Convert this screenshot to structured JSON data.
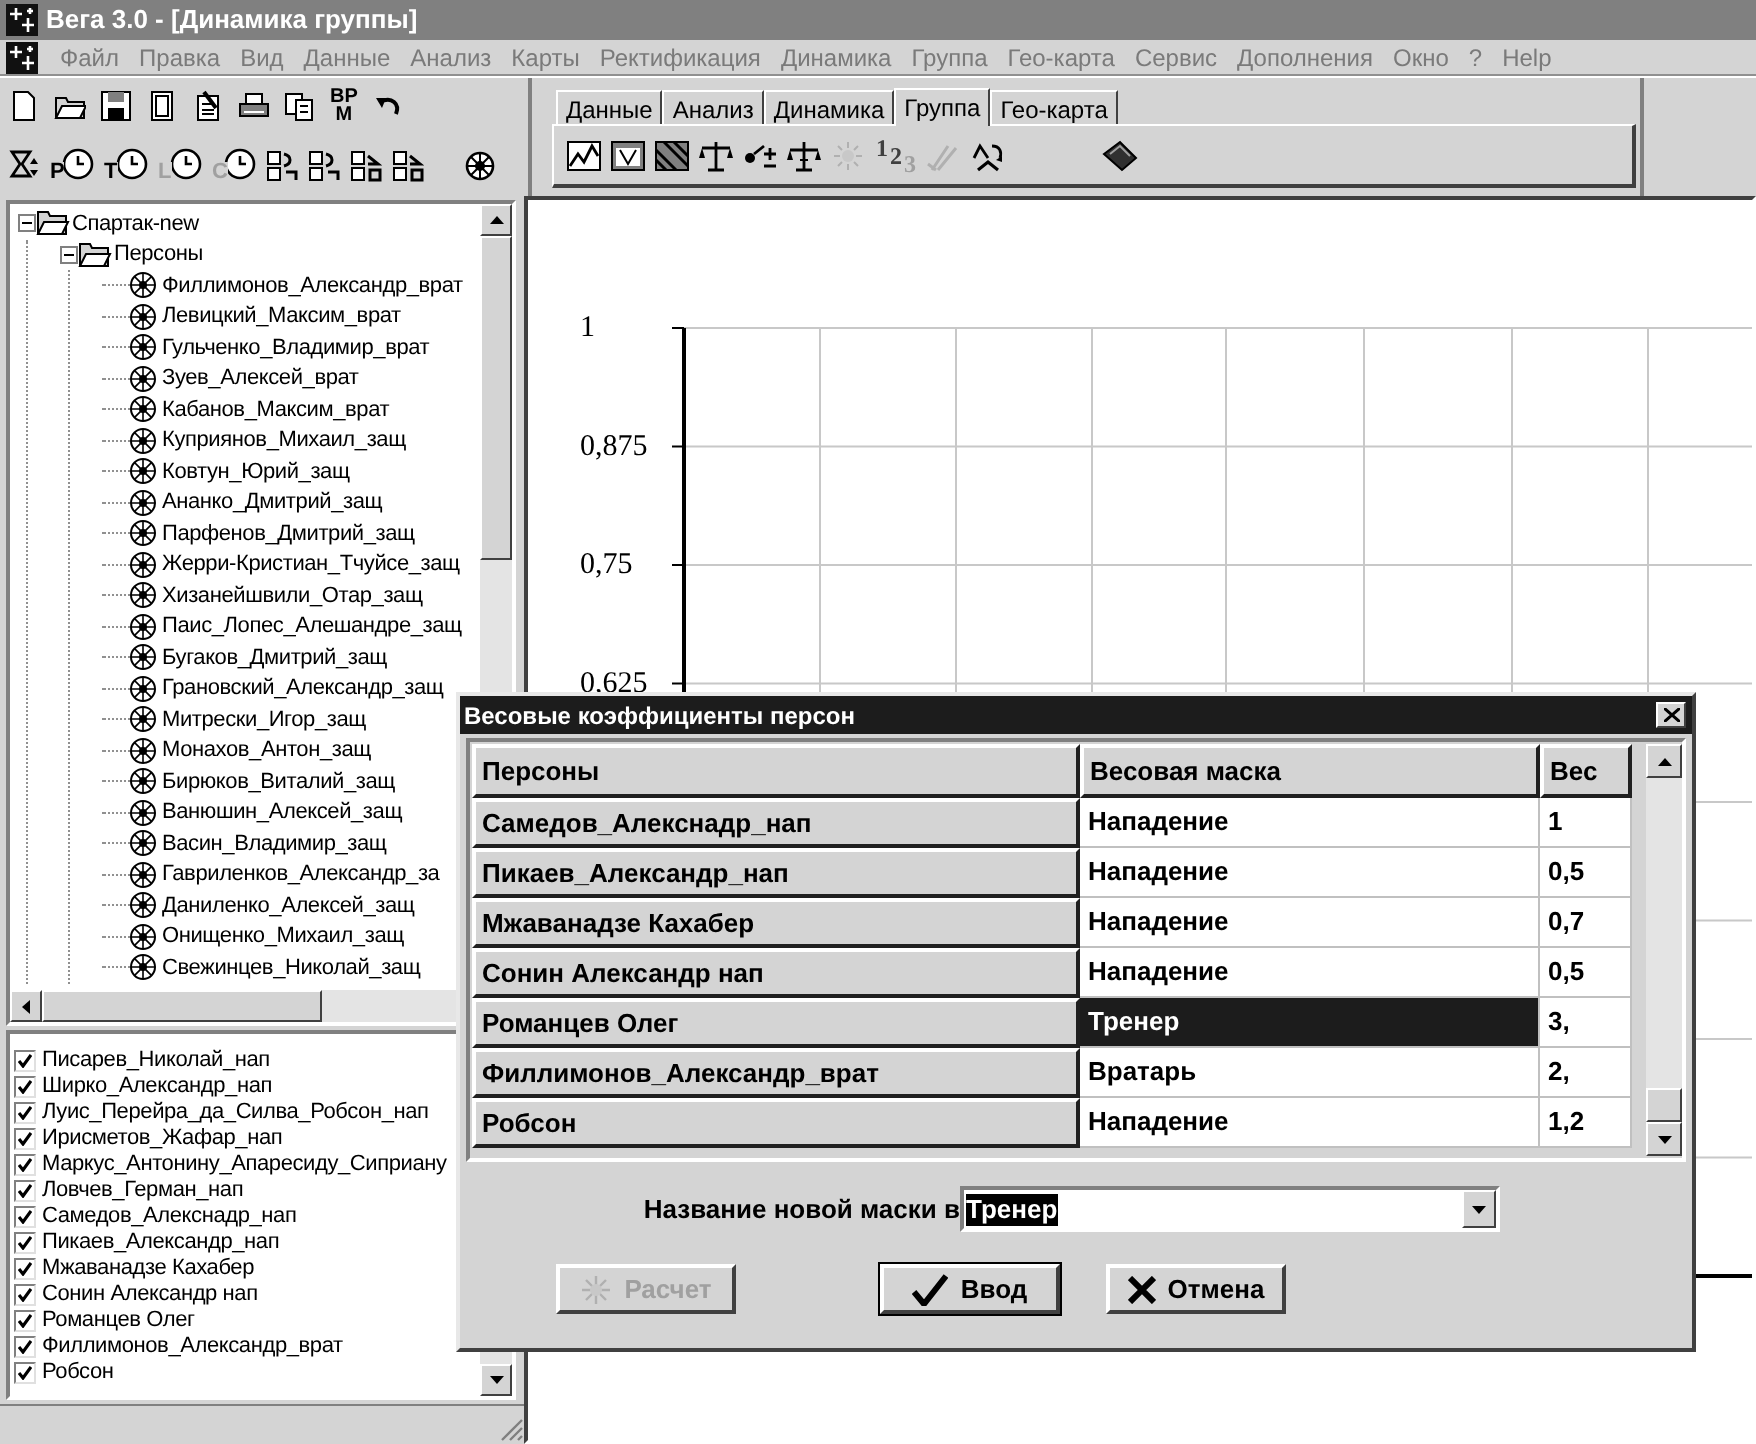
{
  "window": {
    "title": "Вега 3.0 - [Динамика группы]"
  },
  "menu": [
    "Файл",
    "Правка",
    "Вид",
    "Данные",
    "Анализ",
    "Карты",
    "Ректификация",
    "Динамика",
    "Группа",
    "Гео-карта",
    "Сервис",
    "Дополнения",
    "Окно",
    "?",
    "Help"
  ],
  "toolbar": {
    "report_label": [
      "BP",
      "M"
    ],
    "clock_letters": [
      "P",
      "T",
      "L",
      "C"
    ]
  },
  "tabs": [
    {
      "label": "Данные",
      "selected": false
    },
    {
      "label": "Анализ",
      "selected": false
    },
    {
      "label": "Динамика",
      "selected": false
    },
    {
      "label": "Группа",
      "selected": true
    },
    {
      "label": "Гео-карта",
      "selected": false
    }
  ],
  "tab_toolbar": {
    "numbering_label": [
      "1",
      "2",
      "3"
    ]
  },
  "tree": [
    {
      "label": "Спартак-new",
      "expanded": true,
      "children": [
        {
          "label": "Персоны",
          "expanded": true,
          "children": [
            {
              "label": "Филлимонов_Александр_врат"
            },
            {
              "label": "Левицкий_Максим_врат"
            },
            {
              "label": "Гульченко_Владимир_врат"
            },
            {
              "label": "Зуев_Алексей_врат"
            },
            {
              "label": "Кабанов_Максим_врат"
            },
            {
              "label": "Куприянов_Михаил_защ"
            },
            {
              "label": "Ковтун_Юрий_защ"
            },
            {
              "label": "Ананко_Дмитрий_защ"
            },
            {
              "label": "Парфенов_Дмитрий_защ"
            },
            {
              "label": "Жерри-Кристиан_Тчуйсе_защ"
            },
            {
              "label": "Хизанейшвили_Отар_защ"
            },
            {
              "label": "Паис_Лопес_Алешандре_защ"
            },
            {
              "label": "Бугаков_Дмитрий_защ"
            },
            {
              "label": "Грановский_Александр_защ"
            },
            {
              "label": "Митрески_Игор_защ"
            },
            {
              "label": "Монахов_Антон_защ"
            },
            {
              "label": "Бирюков_Виталий_защ"
            },
            {
              "label": "Ванюшин_Алексей_защ"
            },
            {
              "label": "Васин_Владимир_защ"
            },
            {
              "label": "Гавриленков_Александр_за"
            },
            {
              "label": "Даниленко_Алексей_защ"
            },
            {
              "label": "Онищенко_Михаил_защ"
            },
            {
              "label": "Свежинцев_Николай_защ"
            }
          ]
        }
      ]
    }
  ],
  "checklist": [
    {
      "label": "Писарев_Николай_нап",
      "checked": true
    },
    {
      "label": "Ширко_Александр_нап",
      "checked": true
    },
    {
      "label": "Луис_Перейра_да_Силва_Робсон_нап",
      "checked": true
    },
    {
      "label": "Ирисметов_Жафар_нап",
      "checked": true
    },
    {
      "label": "Маркус_Антонину_Апаресиду_Сиприану",
      "checked": true
    },
    {
      "label": "Ловчев_Герман_нап",
      "checked": true
    },
    {
      "label": "Самедов_Алекснадр_нап",
      "checked": true
    },
    {
      "label": "Пикаев_Александр_нап",
      "checked": true
    },
    {
      "label": "Мжаванадзе Кахабер",
      "checked": true
    },
    {
      "label": "Сонин Александр нап",
      "checked": true
    },
    {
      "label": "Романцев Олег",
      "checked": true
    },
    {
      "label": "Филлимонов_Александр_врат",
      "checked": true
    },
    {
      "label": "Робсон",
      "checked": true
    }
  ],
  "chart": {
    "axis_labels": [
      "1",
      "0,875",
      "0,75",
      "0,625"
    ]
  },
  "dialog": {
    "title": "Весовые коэффициенты персон",
    "columns": [
      "Персоны",
      "Весовая маска",
      "Вес"
    ],
    "rows": [
      {
        "person": "Самедов_Алекснадр_нап",
        "mask": "Нападение",
        "weight": "1",
        "selected": false
      },
      {
        "person": "Пикаев_Александр_нап",
        "mask": "Нападение",
        "weight": "0,5",
        "selected": false
      },
      {
        "person": "Мжаванадзе Кахабер",
        "mask": "Нападение",
        "weight": "0,7",
        "selected": false
      },
      {
        "person": "Сонин Александр нап",
        "mask": "Нападение",
        "weight": "0,5",
        "selected": false
      },
      {
        "person": "Романцев Олег",
        "mask": "Тренер",
        "weight": "3,",
        "selected": true
      },
      {
        "person": "Филлимонов_Александр_врат",
        "mask": "Вратарь",
        "weight": "2,",
        "selected": false
      },
      {
        "person": "Робсон",
        "mask": "Нападение",
        "weight": "1,2",
        "selected": false
      }
    ],
    "mask_label": "Название новой маски в",
    "mask_value": "Тренер",
    "buttons": [
      {
        "label": "Расчет",
        "kind": "calc",
        "disabled": true
      },
      {
        "label": "Ввод",
        "kind": "ok",
        "disabled": false
      },
      {
        "label": "Отмена",
        "kind": "cancel",
        "disabled": false
      }
    ]
  }
}
